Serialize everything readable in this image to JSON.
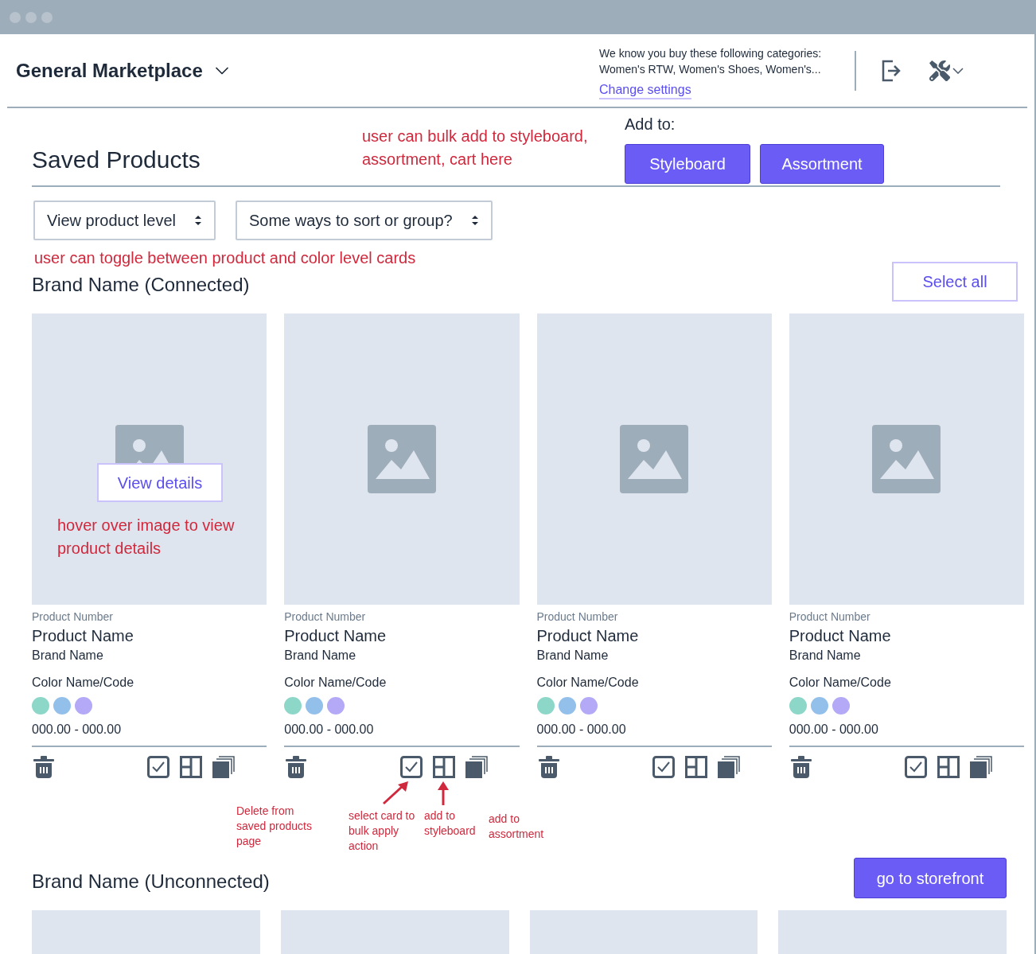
{
  "header": {
    "marketplace": "General Marketplace",
    "notice": "We know you buy these following categories:",
    "categories": "Women's RTW, Women's Shoes, Women's...",
    "settings_link": "Change settings"
  },
  "toolbar": {
    "title": "Saved Products",
    "note_lines": [
      "user can bulk add to styleboard,",
      "assortment, cart here"
    ],
    "add_to_label": "Add to:",
    "add_buttons": [
      "Styleboard",
      "Assortment"
    ]
  },
  "filters": [
    {
      "value": "View product level"
    },
    {
      "value": "Some ways to sort or group?"
    }
  ],
  "toggle_note": "user can toggle between product and color level cards",
  "sections": [
    {
      "title": "Brand Name (Connected)",
      "action": "Select all",
      "kind": "outline",
      "cards": [
        {
          "kind": "full",
          "product_number": "Product Number",
          "product_name": "Product Name",
          "brand": "Brand Name",
          "color_label": "Color Name/Code",
          "swatches": [
            {
              "color": "#8dd7c9"
            },
            {
              "color": "#93c0ea"
            },
            {
              "color": "#b3a9f7"
            }
          ],
          "price": "000.00 - 000.00",
          "hover": {
            "button": "View details",
            "note_lines": [
              "hover over image to view",
              "product details"
            ]
          }
        },
        {
          "kind": "full",
          "product_number": "Product Number",
          "product_name": "Product Name",
          "brand": "Brand Name",
          "color_label": "Color Name/Code",
          "swatches": [
            {
              "color": "#8dd7c9"
            },
            {
              "color": "#93c0ea"
            },
            {
              "color": "#b3a9f7"
            }
          ],
          "price": "000.00 - 000.00"
        },
        {
          "kind": "full",
          "product_number": "Product Number",
          "product_name": "Product Name",
          "brand": "Brand Name",
          "color_label": "Color Name/Code",
          "swatches": [
            {
              "color": "#8dd7c9"
            },
            {
              "color": "#93c0ea"
            },
            {
              "color": "#b3a9f7"
            }
          ],
          "price": "000.00 - 000.00"
        },
        {
          "kind": "full",
          "product_number": "Product Number",
          "product_name": "Product Name",
          "brand": "Brand Name",
          "color_label": "Color Name/Code",
          "swatches": [
            {
              "color": "#8dd7c9"
            },
            {
              "color": "#93c0ea"
            },
            {
              "color": "#b3a9f7"
            }
          ],
          "price": "000.00 - 000.00"
        }
      ],
      "action_notes": [
        {
          "kind": "plain",
          "lines": [
            "Delete from",
            "saved products",
            "page"
          ]
        },
        {
          "kind": "diagonal_arrow",
          "lines": [
            "select card to",
            "bulk apply",
            "action"
          ]
        },
        {
          "kind": "up_arrow",
          "lines": [
            "add to",
            "styleboard"
          ]
        },
        {
          "kind": "plain_low",
          "lines": [
            "add to",
            "assortment"
          ]
        }
      ]
    },
    {
      "title": "Brand Name (Unconnected)",
      "action": "go to storefront",
      "kind": "solid",
      "cards": [
        {
          "kind": "image_only"
        },
        {
          "kind": "image_only"
        },
        {
          "kind": "image_only"
        },
        {
          "kind": "image_only"
        }
      ]
    }
  ]
}
